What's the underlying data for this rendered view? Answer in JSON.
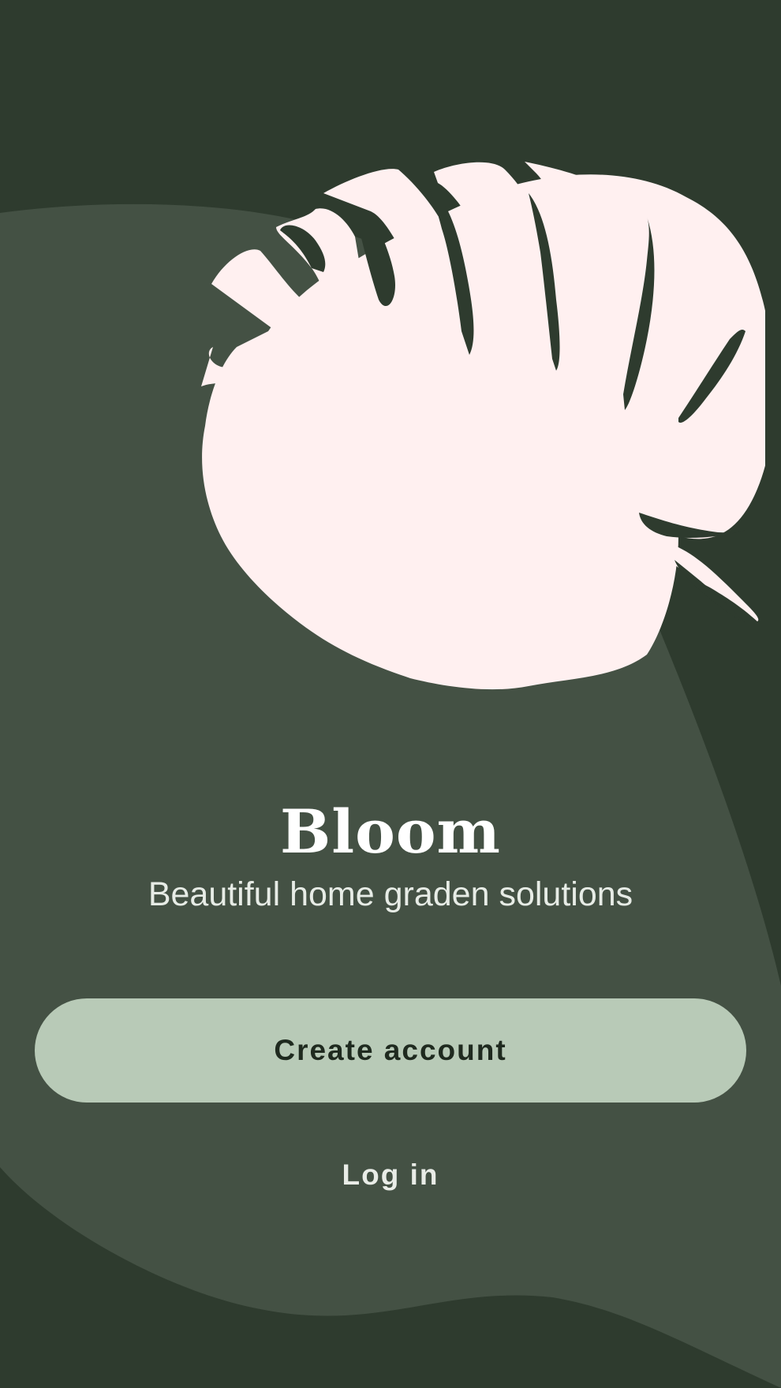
{
  "app": {
    "title": "Bloom",
    "tagline": "Beautiful home graden solutions"
  },
  "actions": {
    "create_account_label": "Create account",
    "log_in_label": "Log in"
  },
  "illustration": {
    "icon": "monstera-leaf-icon"
  },
  "colors": {
    "background_dark": "#2e3b2e",
    "background_light": "#445144",
    "leaf": "#fff0f0",
    "primary_button": "#b8cab7",
    "primary_button_text": "#1f2a1f",
    "text_light": "#ffffff"
  }
}
